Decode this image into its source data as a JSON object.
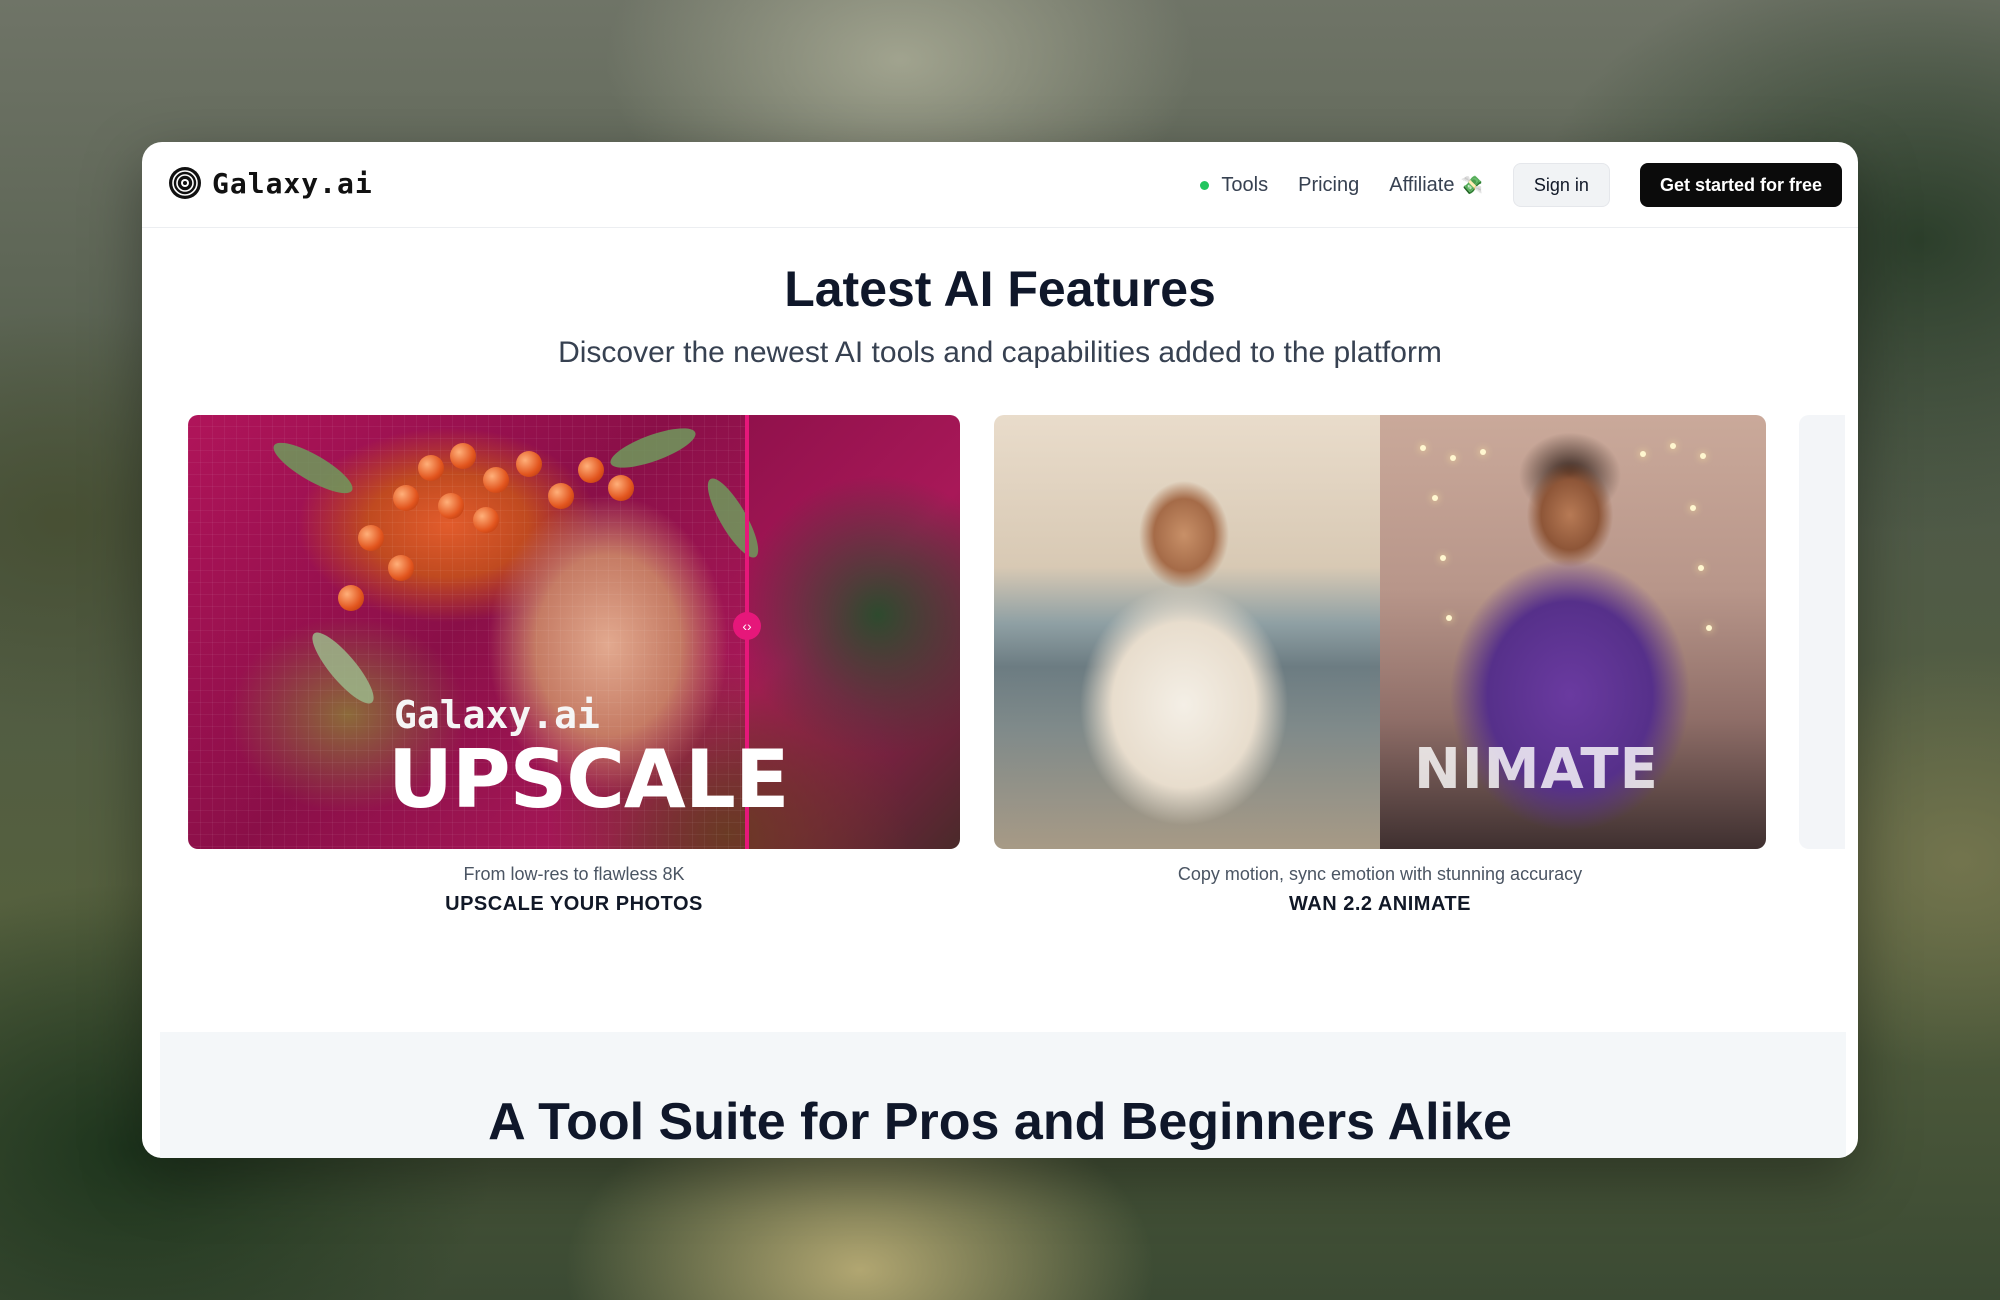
{
  "nav": {
    "logo_text": "Galaxy.ai",
    "links": [
      "Tools",
      "Pricing",
      "Affiliate"
    ],
    "affiliate_emoji": "💸",
    "sign_in": "Sign in",
    "cta": "Get started for free"
  },
  "hero": {
    "title": "Latest AI Features",
    "subtitle": "Discover the newest AI tools and capabilities added to the platform"
  },
  "features": [
    {
      "overlay_brand": "Galaxy.ai",
      "overlay_word": "UPSCALE",
      "caption": "From low-res to flawless 8K",
      "title": "UPSCALE YOUR PHOTOS"
    },
    {
      "overlay_word": "NIMATE",
      "caption": "Copy motion, sync emotion with stunning accuracy",
      "title": "WAN 2.2 ANIMATE"
    }
  ],
  "suite": {
    "title": "A Tool Suite for Pros and Beginners Alike"
  },
  "colors": {
    "accent_pink": "#e6177a",
    "status_green": "#22c55e",
    "cta_bg": "#0b0b0b"
  }
}
